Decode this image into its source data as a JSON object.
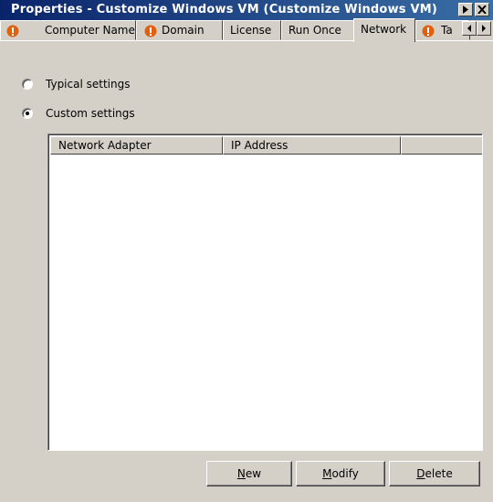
{
  "window": {
    "title": "Properties - Customize Windows VM (Customize Windows VM)",
    "help_icon": "help-arrow-icon",
    "close_icon": "close-icon"
  },
  "tabs": [
    {
      "label": "Computer Name",
      "error": true
    },
    {
      "label": "Domain",
      "error": true
    },
    {
      "label": "License",
      "error": false
    },
    {
      "label": "Run Once",
      "error": false
    },
    {
      "label": "Network",
      "error": false,
      "active": true
    },
    {
      "label": "Ta",
      "error": true
    }
  ],
  "network": {
    "typical_label": "Typical settings",
    "custom_label": "Custom settings",
    "selected": "custom"
  },
  "list": {
    "columns": [
      "Network Adapter",
      "IP Address",
      ""
    ],
    "rows": []
  },
  "buttons": {
    "new_access": "N",
    "new_rest": "ew",
    "modify_access": "M",
    "modify_rest": "odify",
    "delete_access": "D",
    "delete_rest": "elete"
  },
  "colors": {
    "titlebar_start": "#0a246a",
    "titlebar_end": "#3a6ea5",
    "dialog_bg": "#d4d0c8",
    "error_icon": "#e06010"
  }
}
